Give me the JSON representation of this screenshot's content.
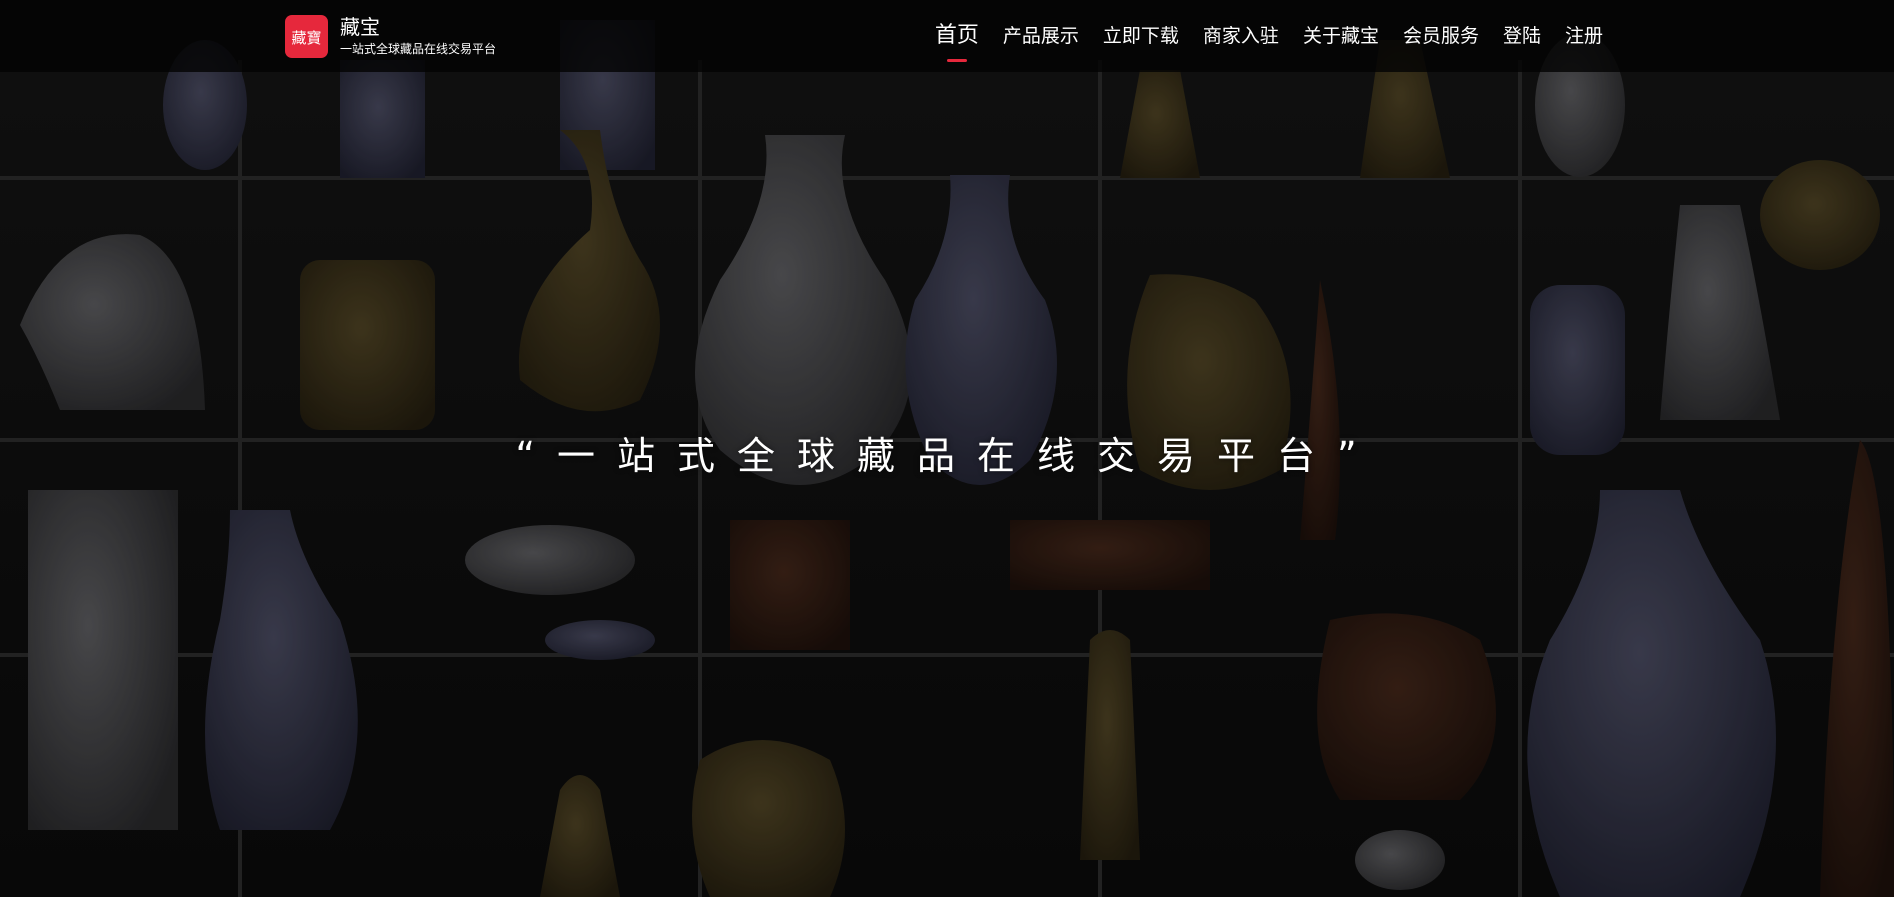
{
  "header": {
    "brand_name": "藏宝",
    "brand_slogan": "一站式全球藏品在线交易平台",
    "logo_glyph": "藏寶",
    "nav": [
      {
        "label": "首页",
        "active": true
      },
      {
        "label": "产品展示",
        "active": false
      },
      {
        "label": "立即下载",
        "active": false
      },
      {
        "label": "商家入驻",
        "active": false
      },
      {
        "label": "关于藏宝",
        "active": false
      },
      {
        "label": "会员服务",
        "active": false
      },
      {
        "label": "登陆",
        "active": false
      },
      {
        "label": "注册",
        "active": false
      }
    ]
  },
  "hero": {
    "quote": "“一站式全球藏品在线交易平台”"
  },
  "colors": {
    "accent": "#e6283c",
    "header_bg": "#050505",
    "text": "#ffffff"
  },
  "icons": {
    "logo": "seal-logo-icon"
  }
}
